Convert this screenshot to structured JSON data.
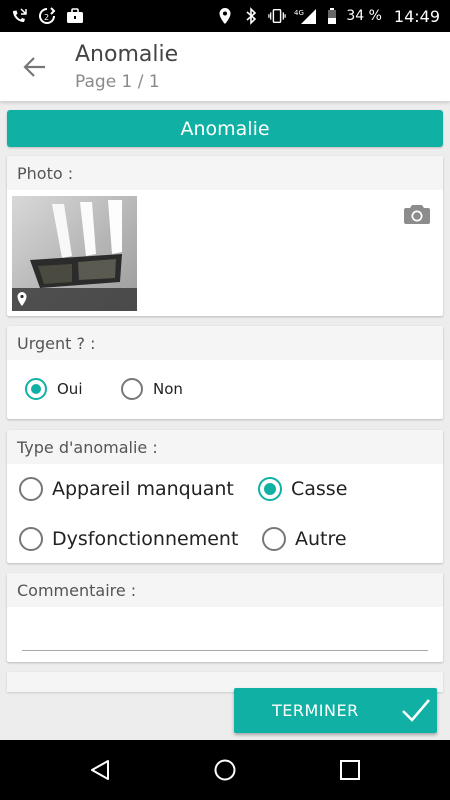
{
  "status_bar": {
    "battery": "34 %",
    "time": "14:49",
    "network": "4G",
    "icons": [
      "missed-call-icon",
      "sync-icon",
      "briefcase-icon",
      "location-icon",
      "bluetooth-icon",
      "vibrate-icon",
      "signal-icon",
      "battery-icon"
    ]
  },
  "app_bar": {
    "title": "Anomalie",
    "subtitle": "Page 1 / 1"
  },
  "section": {
    "title": "Anomalie"
  },
  "photo": {
    "label": "Photo :"
  },
  "urgent": {
    "label": "Urgent ? :",
    "options": [
      {
        "label": "Oui",
        "checked": true
      },
      {
        "label": "Non",
        "checked": false
      }
    ]
  },
  "anomaly_type": {
    "label": "Type d'anomalie :",
    "options": [
      {
        "label": "Appareil manquant",
        "checked": false
      },
      {
        "label": "Casse",
        "checked": true
      },
      {
        "label": "Dysfonctionnement",
        "checked": false
      },
      {
        "label": "Autre",
        "checked": false
      }
    ]
  },
  "comment": {
    "label": "Commentaire :",
    "value": ""
  },
  "footer": {
    "finish_label": "TERMINER"
  },
  "colors": {
    "accent": "#10b0a4",
    "status_bar": "#000000",
    "background": "#ededed"
  }
}
